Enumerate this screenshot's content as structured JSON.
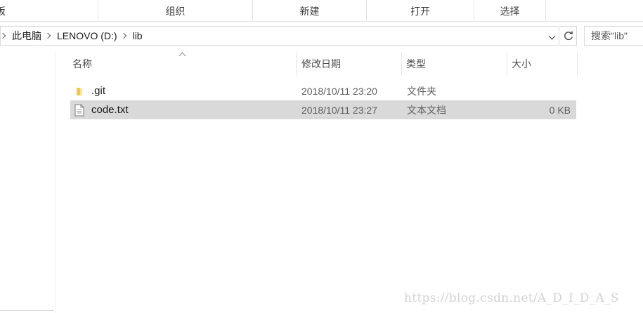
{
  "ribbon": {
    "groups": [
      {
        "label": "板"
      },
      {
        "label": "组织"
      },
      {
        "label": "新建"
      },
      {
        "label": "打开"
      },
      {
        "label": "选择"
      }
    ]
  },
  "address_bar": {
    "crumbs": [
      "此电脑",
      "LENOVO (D:)",
      "lib"
    ]
  },
  "search": {
    "placeholder": "搜索\"lib\""
  },
  "columns": {
    "name": "名称",
    "modified": "修改日期",
    "type": "类型",
    "size": "大小"
  },
  "files": [
    {
      "name": ".git",
      "modified": "2018/10/11 23:20",
      "type": "文件夹",
      "size": "",
      "icon": "folder-icon",
      "selected": false
    },
    {
      "name": "code.txt",
      "modified": "2018/10/11 23:27",
      "type": "文本文档",
      "size": "0 KB",
      "icon": "text-file-icon",
      "selected": true
    }
  ],
  "watermark": "https://blog.csdn.net/A_D_I_D_A_S",
  "colors": {
    "selection": "#d9d9d9",
    "folder": "#f5d57a",
    "border": "#d9d9d9"
  }
}
